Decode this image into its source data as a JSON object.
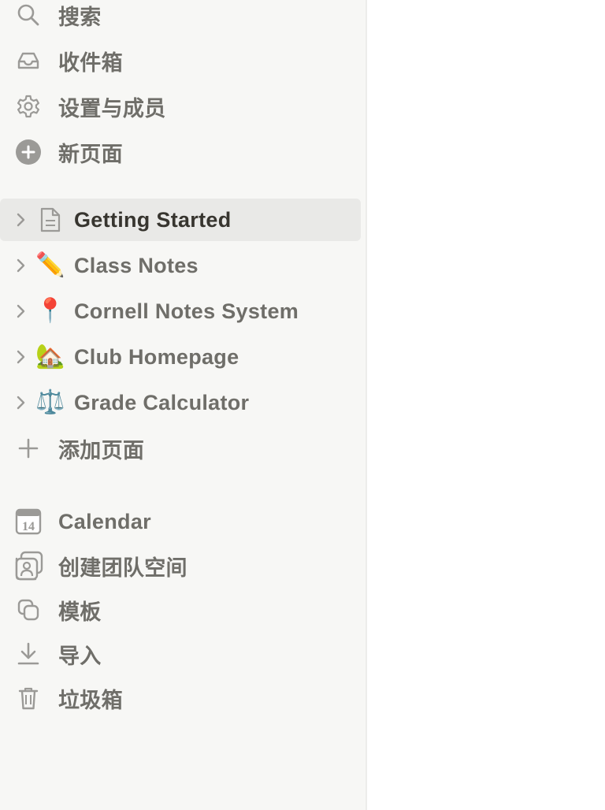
{
  "sidebar": {
    "top_items": [
      {
        "label": "搜索",
        "icon": "search-icon"
      },
      {
        "label": "收件箱",
        "icon": "inbox-icon"
      },
      {
        "label": "设置与成员",
        "icon": "gear-icon"
      },
      {
        "label": "新页面",
        "icon": "plus-circle-icon"
      }
    ],
    "pages": [
      {
        "label": "Getting Started",
        "icon": "page-icon",
        "active": true
      },
      {
        "label": "Class Notes",
        "icon": "pencil-emoji",
        "emoji": "✏️"
      },
      {
        "label": "Cornell Notes System",
        "icon": "pushpin-emoji",
        "emoji": "📍"
      },
      {
        "label": "Club Homepage",
        "icon": "house-emoji",
        "emoji": "🏡"
      },
      {
        "label": "Grade Calculator",
        "icon": "scales-emoji",
        "emoji": "⚖️"
      }
    ],
    "add_page_label": "添加页面",
    "bottom_items": [
      {
        "label": "Calendar",
        "icon": "calendar-icon",
        "calendar_day": "14"
      },
      {
        "label": "创建团队空间",
        "icon": "teamspace-icon"
      },
      {
        "label": "模板",
        "icon": "templates-icon"
      },
      {
        "label": "导入",
        "icon": "import-icon"
      },
      {
        "label": "垃圾箱",
        "icon": "trash-icon"
      }
    ]
  },
  "colors": {
    "sidebar_bg": "#f7f7f5",
    "text_muted": "#6f6e69",
    "text_active": "#37352f",
    "active_bg": "#e9e9e7",
    "icon": "#9b9a97"
  }
}
